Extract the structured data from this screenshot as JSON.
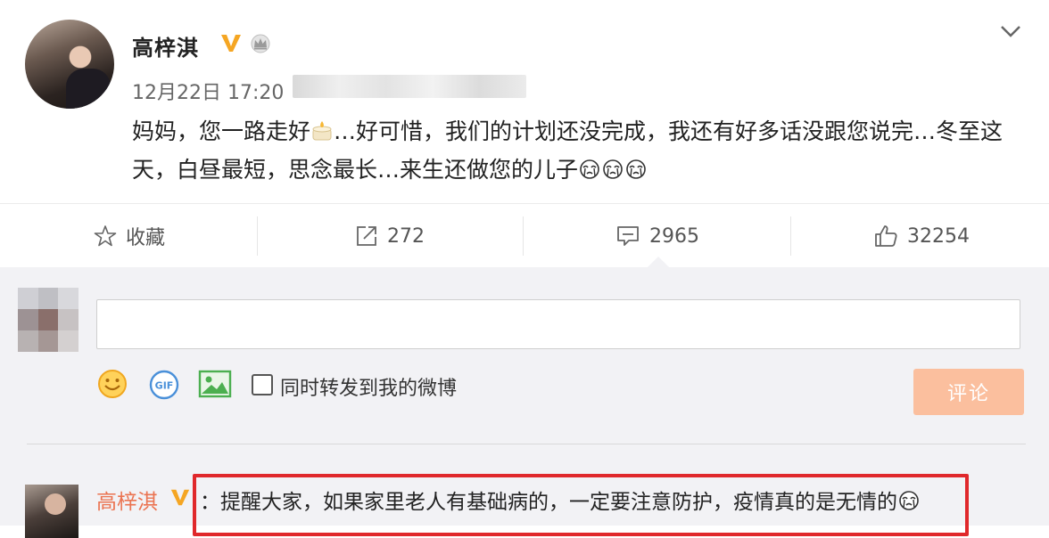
{
  "post": {
    "author": "高梓淇",
    "time": "12月22日 17:20",
    "text_part1": "妈妈，您一路走好",
    "text_part2": "…好可惜，我们的计划还没完成，我还有好多话没跟您说完…冬至这天，白昼最短，思念最长…来生还做您的儿子",
    "icons": {
      "verified": "verified-v-badge",
      "crown": "crown-icon",
      "menu": "chevron-down-icon",
      "candle": "candle-emoji",
      "cry": "crying-emoji"
    }
  },
  "actions": {
    "favorite_label": "收藏",
    "repost_count": "272",
    "comment_count": "2965",
    "like_count": "32254"
  },
  "composer": {
    "input_value": "",
    "repost_label": "同时转发到我的微博",
    "submit_label": "评论"
  },
  "comments": [
    {
      "author": "高梓淇",
      "text": "：提醒大家，如果家里老人有基础病的，一定要注意防护，疫情真的是无情的"
    }
  ],
  "colors": {
    "accent": "#eb7350",
    "verified": "#f5a623",
    "submit_disabled": "#fbbf9e",
    "highlight_border": "#e0282b",
    "panel_bg": "#f2f2f5"
  }
}
